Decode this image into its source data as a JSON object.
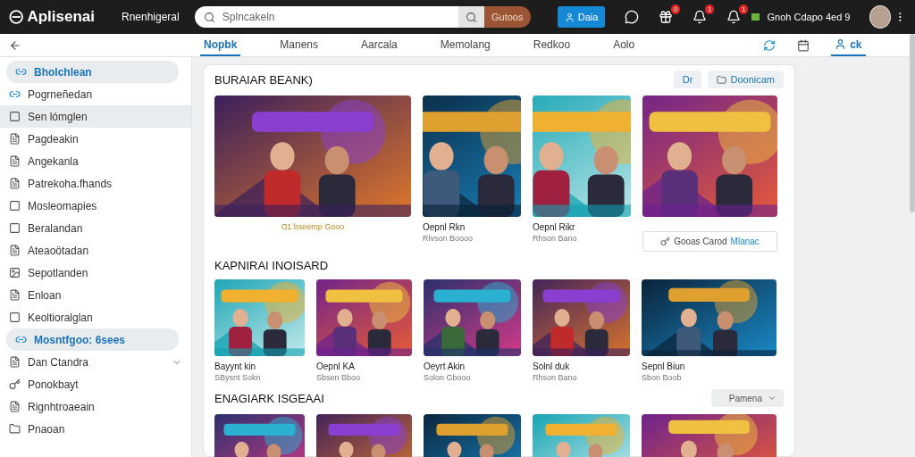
{
  "topbar": {
    "brand": "Aplisenai",
    "subtitle": "Rnenhigeral",
    "search": {
      "placeholder": "Splncakeln"
    },
    "search_button": "Gutoos",
    "primary_button": "Daia",
    "badges": [
      {
        "count": "0"
      },
      {
        "count": "1"
      },
      {
        "count": "1"
      }
    ],
    "user_name": "Gnoh Cdapo 4ed 9"
  },
  "nav": {
    "tabs": [
      {
        "label": "Nopbk",
        "selected": true
      },
      {
        "label": "Manens",
        "selected": false
      },
      {
        "label": "Aarcala",
        "selected": false
      },
      {
        "label": "Memolang",
        "selected": false
      },
      {
        "label": "Redkoo",
        "selected": false
      },
      {
        "label": "Aolo",
        "selected": false
      }
    ],
    "account_tab": {
      "label": "ck",
      "selected": true
    }
  },
  "sidebar": {
    "items": [
      {
        "label": "Bholchlean",
        "selected": true,
        "hovered": false
      },
      {
        "label": "Pogrneñedan",
        "selected": false,
        "hovered": false
      },
      {
        "label": "Sen lómglen",
        "selected": false,
        "hovered": true
      },
      {
        "label": "Pagdeakin",
        "selected": false,
        "hovered": false
      },
      {
        "label": "Angekanla",
        "selected": false,
        "hovered": false
      },
      {
        "label": "Patrekoha.fhands",
        "selected": false,
        "hovered": false
      },
      {
        "label": "Mosleomapies",
        "selected": false,
        "hovered": false
      },
      {
        "label": "Beralandan",
        "selected": false,
        "hovered": false
      },
      {
        "label": "Ateaoötadan",
        "selected": false,
        "hovered": false
      },
      {
        "label": "Sepotlanden",
        "selected": false,
        "hovered": false
      },
      {
        "label": "Enloan",
        "selected": false,
        "hovered": false
      },
      {
        "label": "Keoltioralglan",
        "selected": false,
        "hovered": false
      },
      {
        "label": "Mosntfgoo: 6sees",
        "selected": true,
        "hovered": false
      },
      {
        "label": "Dan Ctandra",
        "selected": false,
        "hovered": false,
        "expandable": true
      },
      {
        "label": "Ponokbayt",
        "selected": false,
        "hovered": false
      },
      {
        "label": "Rignhtroaeain",
        "selected": false,
        "hovered": false
      },
      {
        "label": "Pnaoan",
        "selected": false,
        "hovered": false
      }
    ]
  },
  "sections": [
    {
      "title": "BURAIAR BEANK)",
      "actions": [
        {
          "label": "Dr",
          "icon": false
        },
        {
          "label": "Doonicam",
          "icon": true
        }
      ],
      "cards": [
        {
          "kind": "picture",
          "note": "Ɑ1 bseemp Gooo"
        },
        {
          "kind": "picture",
          "name": "Oepnl Rkn",
          "sub": "Rlvson Boooo"
        },
        {
          "kind": "picture",
          "name": "Oepnl Rikr",
          "sub": "Rhson Bano"
        },
        {
          "kind": "picture"
        }
      ],
      "footer_button": {
        "label": "Gooas Carod",
        "link": "Mlanac"
      }
    },
    {
      "title": "KAPNIRAI INOISARD",
      "cards": [
        {
          "kind": "picture",
          "name": "Bayynt kin",
          "sub": "SBysnt Sokn"
        },
        {
          "kind": "picture",
          "name": "Oepnl KA",
          "sub": "Sbsen Bboo"
        },
        {
          "kind": "picture",
          "name": "Oeyrt Akin",
          "sub": "Solon Gbooo"
        },
        {
          "kind": "picture",
          "name": "Solnl duk",
          "sub": "Rhson Bano"
        },
        {
          "kind": "picture",
          "name": "Sepnl Biun",
          "sub": "Sbon Boob"
        }
      ]
    },
    {
      "title": "ENAGIARK ISGEAAI",
      "dropdown": "Pamena",
      "cards": [
        {
          "kind": "picture"
        },
        {
          "kind": "picture"
        },
        {
          "kind": "picture"
        },
        {
          "kind": "picture"
        },
        {
          "kind": "picture"
        }
      ]
    }
  ]
}
